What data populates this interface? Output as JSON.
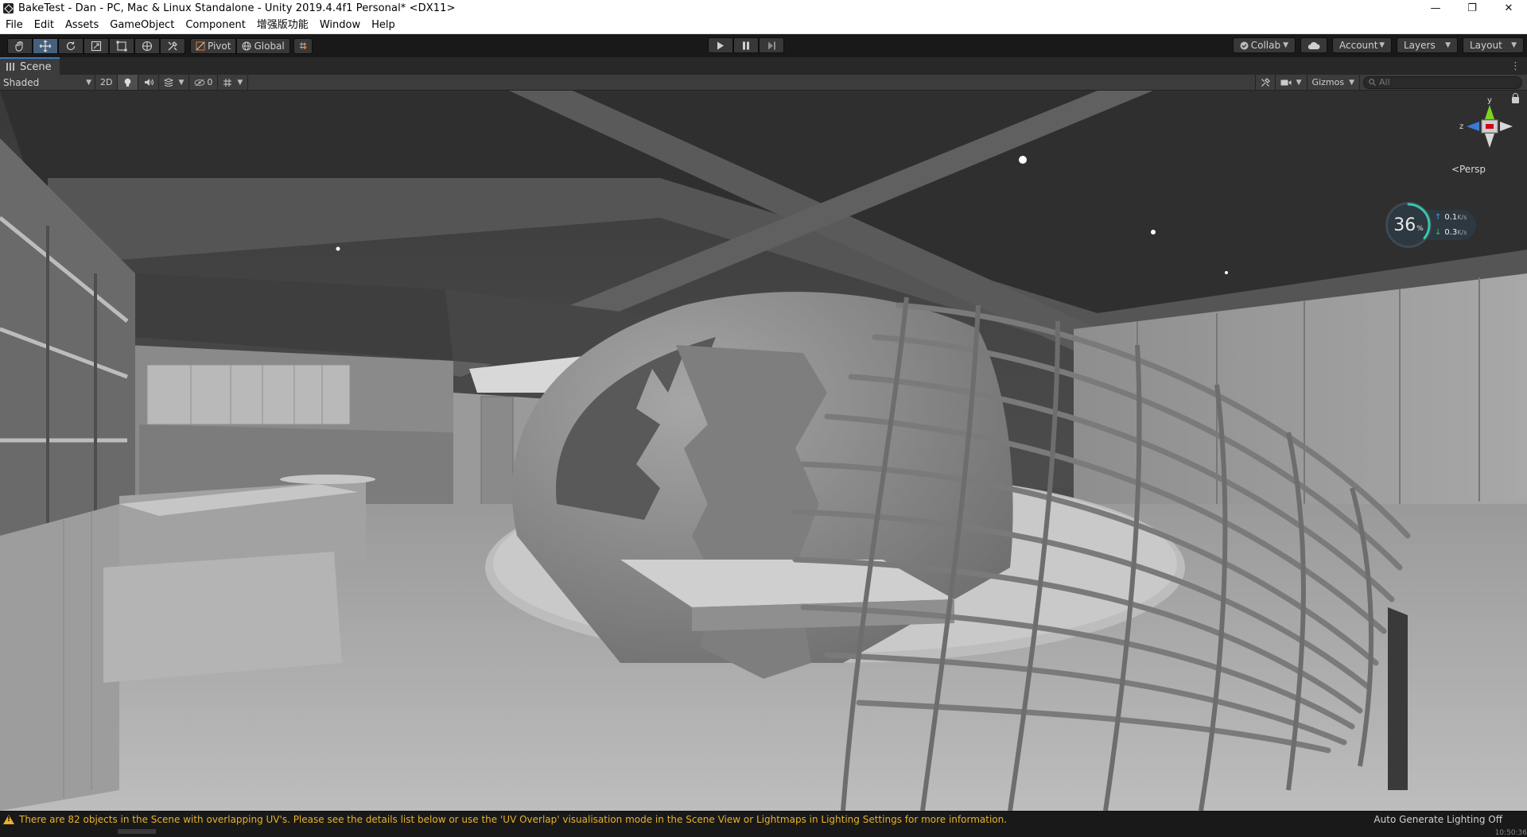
{
  "window": {
    "title": "BakeTest - Dan - PC, Mac & Linux Standalone - Unity 2019.4.4f1 Personal* <DX11>",
    "controls": {
      "minimize": "—",
      "restore": "❐",
      "close": "✕"
    }
  },
  "menu": [
    "File",
    "Edit",
    "Assets",
    "GameObject",
    "Component",
    "增强版功能",
    "Window",
    "Help"
  ],
  "toolbar": {
    "tools": [
      "hand-icon",
      "move-icon",
      "rotate-icon",
      "scale-icon",
      "rect-icon",
      "transform-icon",
      "custom-tool-icon"
    ],
    "active_tool": "move-icon",
    "pivot_label": "Pivot",
    "global_label": "Global",
    "collab_label": "Collab",
    "account_label": "Account",
    "layers_label": "Layers",
    "layout_label": "Layout"
  },
  "scene_tab": {
    "label": "Scene"
  },
  "scene_toolbar": {
    "draw_mode": "Shaded",
    "mode_2d": "2D",
    "hidden_count": "0",
    "gizmos_label": "Gizmos",
    "search_placeholder": "All"
  },
  "view": {
    "projection_label": "Persp",
    "axis_y": "y",
    "axis_z": "z"
  },
  "perf": {
    "percent": "36",
    "percent_unit": "%",
    "upload": "0.1",
    "download": "0.3",
    "rate_unit": "K/s"
  },
  "status": {
    "warning": "There are 82 objects in the Scene with overlapping UV's. Please see the details list below or use the 'UV Overlap' visualisation mode in the Scene View or Lightmaps in Lighting Settings for more information.",
    "lighting": "Auto Generate Lighting Off",
    "clock": "10:50:36"
  },
  "colors": {
    "accent": "#3a79bb",
    "warning": "#e8b22a",
    "active_tool": "#46607c"
  }
}
